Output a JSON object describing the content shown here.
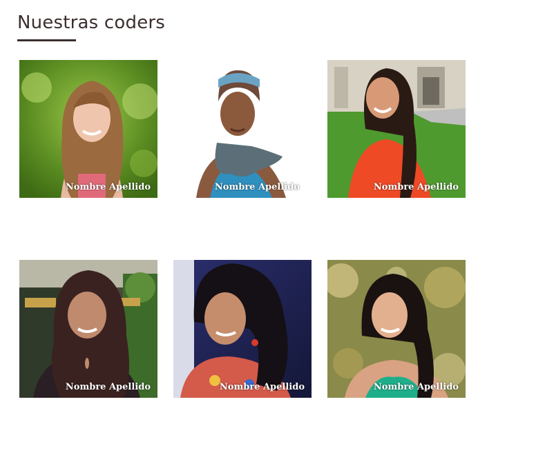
{
  "section": {
    "title": "Nuestras coders"
  },
  "coders": [
    {
      "name": "Nombre Apellido",
      "photo": "portrait-long-brown-hair-green-foliage"
    },
    {
      "name": "Nombre Apellido",
      "photo": "portrait-headscarf-white-background"
    },
    {
      "name": "Nombre Apellido",
      "photo": "portrait-red-blouse-campus-lawn"
    },
    {
      "name": "Nombre Apellido",
      "photo": "portrait-long-dark-hair-storefront"
    },
    {
      "name": "Nombre Apellido",
      "photo": "portrait-curly-hair-blue-background"
    },
    {
      "name": "Nombre Apellido",
      "photo": "portrait-teal-top-bokeh-background"
    }
  ],
  "colors": {
    "title_text": "#3b2f2e",
    "caption_text": "#ffffff"
  }
}
